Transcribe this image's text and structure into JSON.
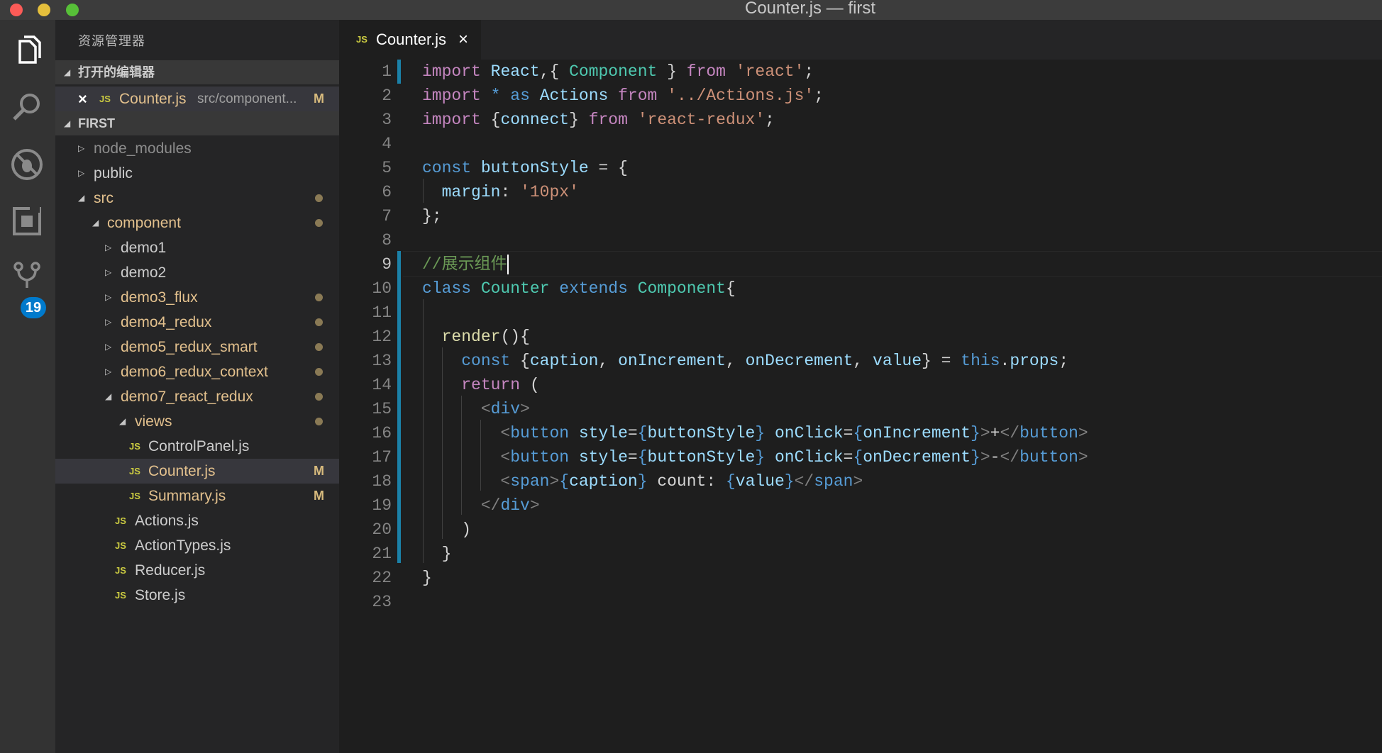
{
  "window": {
    "title": "Counter.js — first"
  },
  "activity_bar": {
    "icons": [
      "files-icon",
      "search-icon",
      "debug-icon",
      "extensions-icon",
      "source-control-icon"
    ],
    "scm_badge": "19"
  },
  "sidebar": {
    "title": "资源管理器",
    "open_editors": {
      "header": "打开的编辑器",
      "items": [
        {
          "name": "Counter.js",
          "path": "src/component...",
          "status": "M"
        }
      ]
    },
    "project": {
      "header": "FIRST",
      "items": [
        {
          "name": "node_modules"
        },
        {
          "name": "public"
        },
        {
          "name": "src"
        },
        {
          "name": "component"
        },
        {
          "name": "demo1"
        },
        {
          "name": "demo2"
        },
        {
          "name": "demo3_flux"
        },
        {
          "name": "demo4_redux"
        },
        {
          "name": "demo5_redux_smart"
        },
        {
          "name": "demo6_redux_context"
        },
        {
          "name": "demo7_react_redux"
        },
        {
          "name": "views"
        },
        {
          "name": "ControlPanel.js"
        },
        {
          "name": "Counter.js",
          "status": "M"
        },
        {
          "name": "Summary.js",
          "status": "M"
        },
        {
          "name": "Actions.js"
        },
        {
          "name": "ActionTypes.js"
        },
        {
          "name": "Reducer.js"
        },
        {
          "name": "Store.js"
        }
      ]
    }
  },
  "tabs": [
    {
      "icon": "JS",
      "label": "Counter.js",
      "close": "×"
    }
  ],
  "editor": {
    "line_numbers": [
      "1",
      "2",
      "3",
      "4",
      "5",
      "6",
      "7",
      "8",
      "9",
      "10",
      "11",
      "12",
      "13",
      "14",
      "15",
      "16",
      "17",
      "18",
      "19",
      "20",
      "21",
      "22",
      "23"
    ],
    "lines": [
      "import React,{ Component } from 'react';",
      "import * as Actions from '../Actions.js';",
      "import {connect} from 'react-redux';",
      "",
      "const buttonStyle = {",
      "  margin: '10px'",
      "};",
      "",
      "//展示组件",
      "class Counter extends Component{",
      "",
      "  render(){",
      "    const {caption, onIncrement, onDecrement, value} = this.props;",
      "    return (",
      "      <div>",
      "        <button style={buttonStyle} onClick={onIncrement}>+</button>",
      "        <button style={buttonStyle} onClick={onDecrement}>-</button>",
      "        <span>{caption} count: {value}</span>",
      "      </div>",
      "    )",
      "  }",
      "}",
      ""
    ]
  }
}
